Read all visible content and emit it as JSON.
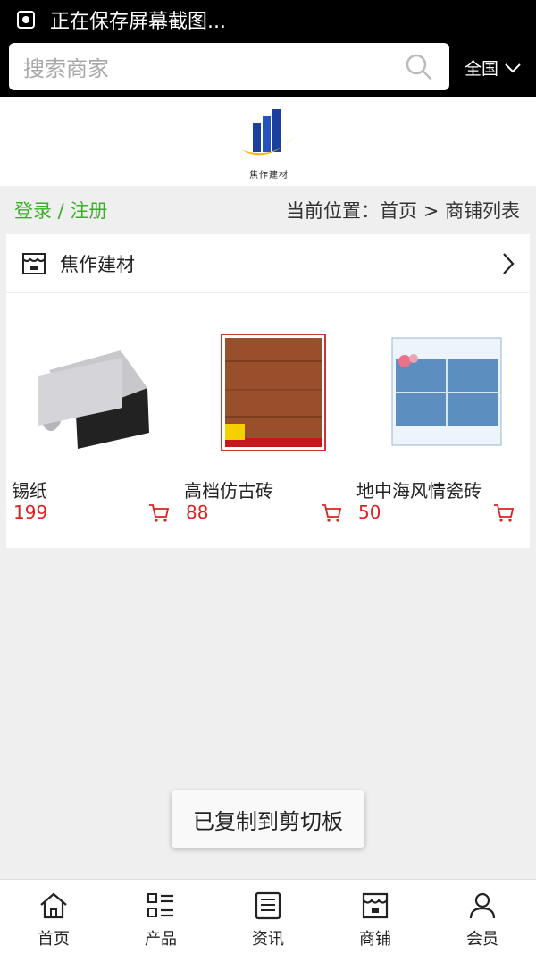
{
  "status_bar": {
    "text": "正在保存屏幕截图..."
  },
  "header": {
    "search_placeholder": "搜索商家",
    "region": "全国"
  },
  "logo": {
    "text": "焦作建材"
  },
  "crumb": {
    "login": "登录 / 注册",
    "location": "当前位置：首页 > 商铺列表"
  },
  "shop": {
    "name": "焦作建材",
    "products": [
      {
        "name": "锡纸",
        "price": "199"
      },
      {
        "name": "高档仿古砖",
        "price": "88"
      },
      {
        "name": "地中海风情瓷砖",
        "price": "50"
      }
    ]
  },
  "toast": {
    "text": "已复制到剪切板"
  },
  "tabs": [
    {
      "label": "首页",
      "icon": "home-icon"
    },
    {
      "label": "产品",
      "icon": "list-icon"
    },
    {
      "label": "资讯",
      "icon": "news-icon"
    },
    {
      "label": "商铺",
      "icon": "shop-icon"
    },
    {
      "label": "会员",
      "icon": "user-icon"
    }
  ],
  "colors": {
    "accent_green": "#3dae2b",
    "price_red": "#e02020",
    "header_bg": "#000000"
  }
}
